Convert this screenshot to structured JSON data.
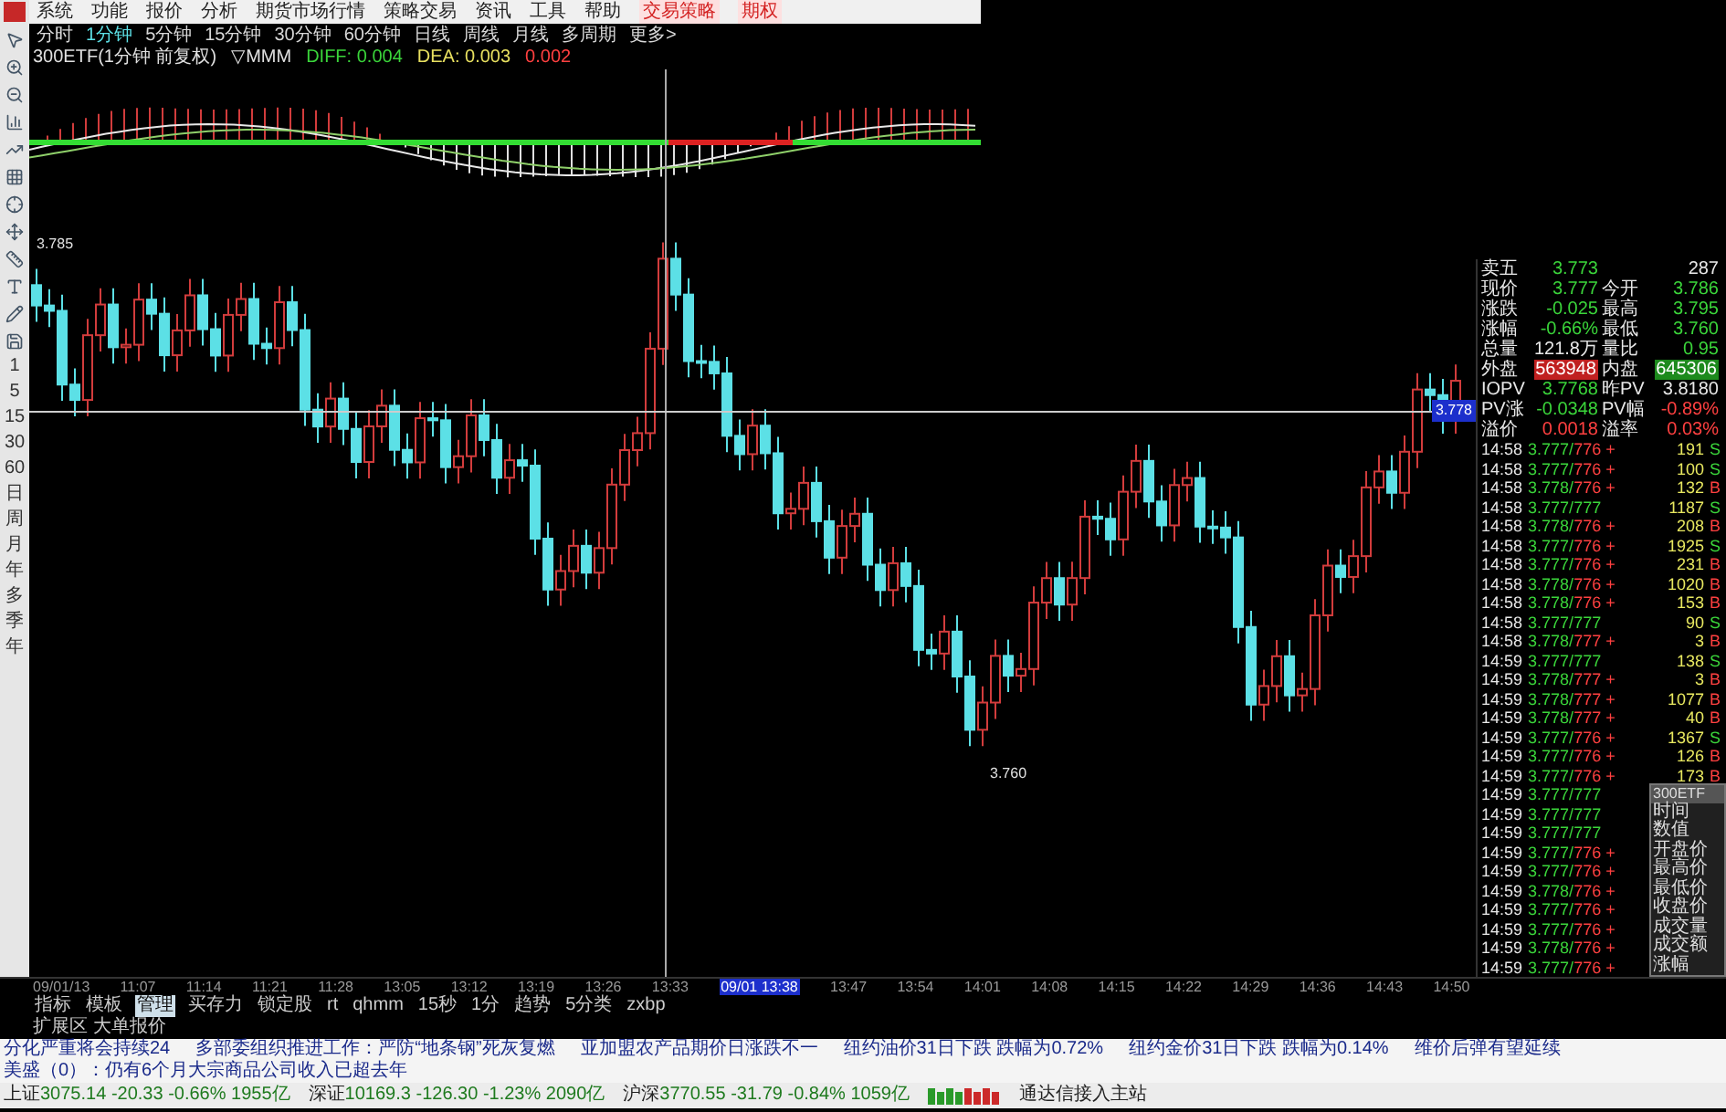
{
  "menu": [
    {
      "label": "系统",
      "highlighted": false
    },
    {
      "label": "功能",
      "highlighted": false
    },
    {
      "label": "报价",
      "highlighted": false
    },
    {
      "label": "分析",
      "highlighted": false
    },
    {
      "label": "期货市场行情",
      "highlighted": false
    },
    {
      "label": "策略交易",
      "highlighted": false
    },
    {
      "label": "资讯",
      "highlighted": false
    },
    {
      "label": "工具",
      "highlighted": false
    },
    {
      "label": "帮助",
      "highlighted": false
    },
    {
      "label": "交易策略",
      "highlighted": true
    },
    {
      "label": "期权",
      "highlighted": true
    }
  ],
  "periods": [
    {
      "label": "分时",
      "selected": false
    },
    {
      "label": "1分钟",
      "selected": true
    },
    {
      "label": "5分钟",
      "selected": false
    },
    {
      "label": "15分钟",
      "selected": false
    },
    {
      "label": "30分钟",
      "selected": false
    },
    {
      "label": "60分钟",
      "selected": false
    },
    {
      "label": "日线",
      "selected": false
    },
    {
      "label": "周线",
      "selected": false
    },
    {
      "label": "月线",
      "selected": false
    },
    {
      "label": "多周期",
      "selected": false
    },
    {
      "label": "更多>",
      "selected": false
    }
  ],
  "indicator_header": {
    "title": "300ETF(1分钟 前复权)",
    "name": "▽MMM",
    "diff": "DIFF: 0.004",
    "dea": "DEA: 0.003",
    "macd": "0.002"
  },
  "toolbar": {
    "labels": [
      "1",
      "5",
      "15",
      "30",
      "60",
      "日",
      "周",
      "月",
      "年",
      "多",
      "季",
      "年"
    ]
  },
  "chart": {
    "high_label": "3.785",
    "low_label": "3.760",
    "cursor_price": "3.778"
  },
  "time_axis": [
    {
      "label": "09/01/13",
      "cursor": false
    },
    {
      "label": "11:07",
      "cursor": false
    },
    {
      "label": "11:14",
      "cursor": false
    },
    {
      "label": "11:21",
      "cursor": false
    },
    {
      "label": "11:28",
      "cursor": false
    },
    {
      "label": "13:05",
      "cursor": false
    },
    {
      "label": "13:12",
      "cursor": false
    },
    {
      "label": "13:19",
      "cursor": false
    },
    {
      "label": "13:26",
      "cursor": false
    },
    {
      "label": "13:33",
      "cursor": false
    },
    {
      "label": "09/01 13:38",
      "cursor": true
    },
    {
      "label": "13:47",
      "cursor": false
    },
    {
      "label": "13:54",
      "cursor": false
    },
    {
      "label": "14:01",
      "cursor": false
    },
    {
      "label": "14:08",
      "cursor": false
    },
    {
      "label": "14:15",
      "cursor": false
    },
    {
      "label": "14:22",
      "cursor": false
    },
    {
      "label": "14:29",
      "cursor": false
    },
    {
      "label": "14:36",
      "cursor": false
    },
    {
      "label": "14:43",
      "cursor": false
    },
    {
      "label": "14:50",
      "cursor": false
    }
  ],
  "bottom_tabs": [
    {
      "label": "指标",
      "selected": false
    },
    {
      "label": "模板",
      "selected": false
    },
    {
      "label": "管理",
      "selected": true
    },
    {
      "label": "买存力",
      "selected": false
    },
    {
      "label": "锁定股",
      "selected": false
    },
    {
      "label": "rt",
      "selected": false
    },
    {
      "label": "qhmm",
      "selected": false
    },
    {
      "label": "15秒",
      "selected": false
    },
    {
      "label": "1分",
      "selected": false
    },
    {
      "label": "趋势",
      "selected": false
    },
    {
      "label": "5分类",
      "selected": false
    },
    {
      "label": "zxbp",
      "selected": false
    }
  ],
  "extension": "扩展区 大单报价",
  "news": [
    "分化严重将会持续24",
    "多部委组织推进工作：严防“地条钢”死灰复燃",
    "亚加盟农产品期价日涨跌不一",
    "纽约油价31日下跌 跌幅为0.72%",
    "纽约金价31日下跌 跌幅为0.14%",
    "维价后弹有望延续",
    "美盛（0）：仍有6个月大宗商品公司收入已超去年"
  ],
  "status_bar": {
    "indices": [
      {
        "name": "上证",
        "value": "3075.14",
        "change": "-20.33",
        "pct": "-0.66%",
        "amount": "1955亿"
      },
      {
        "name": "深证",
        "value": "10169.3",
        "change": "-126.30",
        "pct": "-1.23%",
        "amount": "2090亿"
      },
      {
        "name": "沪深",
        "value": "3770.55",
        "change": "-31.79",
        "pct": "-0.84%",
        "amount": "1059亿"
      }
    ],
    "connection": "通达信接入主站"
  },
  "quote": {
    "rows": [
      [
        {
          "label": "卖五",
          "value": "3.773",
          "kind": "down"
        },
        {
          "value": "287",
          "kind": "neutral"
        }
      ],
      [
        {
          "label": "现价",
          "value": "3.777",
          "kind": "down"
        },
        {
          "label": "今开",
          "value": "3.786",
          "kind": "down"
        }
      ],
      [
        {
          "label": "涨跌",
          "value": "-0.025",
          "kind": "down"
        },
        {
          "label": "最高",
          "value": "3.795",
          "kind": "down"
        }
      ],
      [
        {
          "label": "涨幅",
          "value": "-0.66%",
          "kind": "down"
        },
        {
          "label": "最低",
          "value": "3.760",
          "kind": "down"
        }
      ],
      [
        {
          "label": "总量",
          "value": "121.8万",
          "kind": "neutral"
        },
        {
          "label": "量比",
          "value": "0.95",
          "kind": "down"
        }
      ],
      [
        {
          "label": "外盘",
          "value": "563948",
          "kind": "up_box"
        },
        {
          "label": "内盘",
          "value": "645306",
          "kind": "down_box"
        }
      ],
      [
        {
          "label": "IOPV",
          "value": "3.7768",
          "kind": "down"
        },
        {
          "label": "昨PV",
          "value": "3.8180",
          "kind": "neutral"
        }
      ],
      [
        {
          "label": "PV涨",
          "value": "-0.0348",
          "kind": "down"
        },
        {
          "label": "PV幅",
          "value": "-0.89%",
          "kind": "up"
        }
      ],
      [
        {
          "label": "溢价",
          "value": "0.0018",
          "kind": "up"
        },
        {
          "label": "溢率",
          "value": "0.03%",
          "kind": "up"
        }
      ]
    ],
    "ticks": [
      {
        "time": "14:58",
        "price": "3.777/",
        "bid": "776 +",
        "kind": "up",
        "vol": "191",
        "flag": {
          "text": "S",
          "kind": "sell"
        }
      },
      {
        "time": "14:58",
        "price": "3.777/",
        "bid": "776 +",
        "kind": "up",
        "vol": "100",
        "flag": {
          "text": "S",
          "kind": "sell"
        }
      },
      {
        "time": "14:58",
        "price": "3.778/",
        "bid": "776 +",
        "kind": "up",
        "vol": "132",
        "flag": {
          "text": "B",
          "kind": "buy"
        }
      },
      {
        "time": "14:58",
        "price": "3.777/",
        "bid": "777",
        "kind": "flat",
        "vol": "1187",
        "flag": {
          "text": "S",
          "kind": "sell"
        }
      },
      {
        "time": "14:58",
        "price": "3.778/",
        "bid": "776 +",
        "kind": "up",
        "vol": "208",
        "flag": {
          "text": "B",
          "kind": "buy"
        }
      },
      {
        "time": "14:58",
        "price": "3.777/",
        "bid": "776 +",
        "kind": "up",
        "vol": "1925",
        "flag": {
          "text": "S",
          "kind": "sell"
        }
      },
      {
        "time": "14:58",
        "price": "3.777/",
        "bid": "776 +",
        "kind": "up",
        "vol": "231",
        "flag": {
          "text": "B",
          "kind": "buy"
        }
      },
      {
        "time": "14:58",
        "price": "3.778/",
        "bid": "776 +",
        "kind": "up",
        "vol": "1020",
        "flag": {
          "text": "B",
          "kind": "buy"
        }
      },
      {
        "time": "14:58",
        "price": "3.778/",
        "bid": "776 +",
        "kind": "up",
        "vol": "153",
        "flag": {
          "text": "B",
          "kind": "buy"
        }
      },
      {
        "time": "14:58",
        "price": "3.777/",
        "bid": "777",
        "kind": "flat",
        "vol": "90",
        "flag": {
          "text": "S",
          "kind": "sell"
        }
      },
      {
        "time": "14:58",
        "price": "3.778/",
        "bid": "777 +",
        "kind": "up",
        "vol": "3",
        "flag": {
          "text": "B",
          "kind": "buy"
        }
      },
      {
        "time": "14:59",
        "price": "3.777/",
        "bid": "777",
        "kind": "flat",
        "vol": "138",
        "flag": {
          "text": "S",
          "kind": "sell"
        }
      },
      {
        "time": "14:59",
        "price": "3.778/",
        "bid": "777 +",
        "kind": "up",
        "vol": "3",
        "flag": {
          "text": "B",
          "kind": "buy"
        }
      },
      {
        "time": "14:59",
        "price": "3.778/",
        "bid": "777 +",
        "kind": "up",
        "vol": "1077",
        "flag": {
          "text": "B",
          "kind": "buy"
        }
      },
      {
        "time": "14:59",
        "price": "3.778/",
        "bid": "777 +",
        "kind": "up",
        "vol": "40",
        "flag": {
          "text": "B",
          "kind": "buy"
        }
      },
      {
        "time": "14:59",
        "price": "3.777/",
        "bid": "776 +",
        "kind": "up",
        "vol": "1367",
        "flag": {
          "text": "S",
          "kind": "sell"
        }
      },
      {
        "time": "14:59",
        "price": "3.777/",
        "bid": "776 +",
        "kind": "up",
        "vol": "126",
        "flag": {
          "text": "B",
          "kind": "buy"
        }
      },
      {
        "time": "14:59",
        "price": "3.777/",
        "bid": "776 +",
        "kind": "up",
        "vol": "173",
        "flag": {
          "text": "B",
          "kind": "buy"
        }
      },
      {
        "time": "14:59",
        "price": "3.777/",
        "bid": "777",
        "kind": "flat"
      },
      {
        "time": "14:59",
        "price": "3.777/",
        "bid": "777",
        "kind": "flat"
      },
      {
        "time": "14:59",
        "price": "3.777/",
        "bid": "777",
        "kind": "flat"
      },
      {
        "time": "14:59",
        "price": "3.777/",
        "bid": "776 +",
        "kind": "up"
      },
      {
        "time": "14:59",
        "price": "3.777/",
        "bid": "776 +",
        "kind": "up"
      },
      {
        "time": "14:59",
        "price": "3.778/",
        "bid": "776 +",
        "kind": "up"
      },
      {
        "time": "14:59",
        "price": "3.777/",
        "bid": "776 +",
        "kind": "up"
      },
      {
        "time": "14:59",
        "price": "3.777/",
        "bid": "776 +",
        "kind": "up"
      },
      {
        "time": "14:59",
        "price": "3.778/",
        "bid": "776 +",
        "kind": "up"
      },
      {
        "time": "14:59",
        "price": "3.777/",
        "bid": "776 +",
        "kind": "up"
      }
    ],
    "popup": {
      "title": "300ETF",
      "labels": [
        "时间",
        "数值",
        "开盘价",
        "最高价",
        "最低价",
        "收盘价",
        "成交量",
        "成交额",
        "涨幅"
      ]
    }
  }
}
